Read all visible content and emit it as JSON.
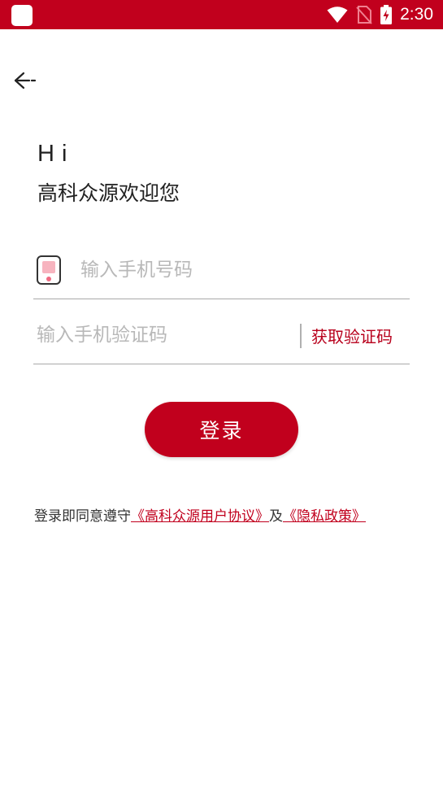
{
  "status_bar": {
    "time": "2:30",
    "background_color": "#c1001d",
    "icons": [
      "app-icon",
      "wifi-icon",
      "no-sim-icon",
      "battery-charging-icon"
    ]
  },
  "header": {
    "back_icon": "back-arrow-icon"
  },
  "greeting": {
    "hi": "Hi",
    "welcome": "高科众源欢迎您"
  },
  "form": {
    "phone": {
      "icon": "phone-icon",
      "value": "",
      "placeholder": "输入手机号码"
    },
    "code": {
      "value": "",
      "placeholder": "输入手机验证码"
    },
    "get_code_label": "获取验证码"
  },
  "login_button": {
    "label": "登录",
    "color": "#c1001d"
  },
  "agreement": {
    "prefix": "登录即同意遵守",
    "user_agreement": "《高科众源用户协议》",
    "conjunction": "及",
    "privacy_policy": "《隐私政策》",
    "link_color": "#c1001d"
  }
}
